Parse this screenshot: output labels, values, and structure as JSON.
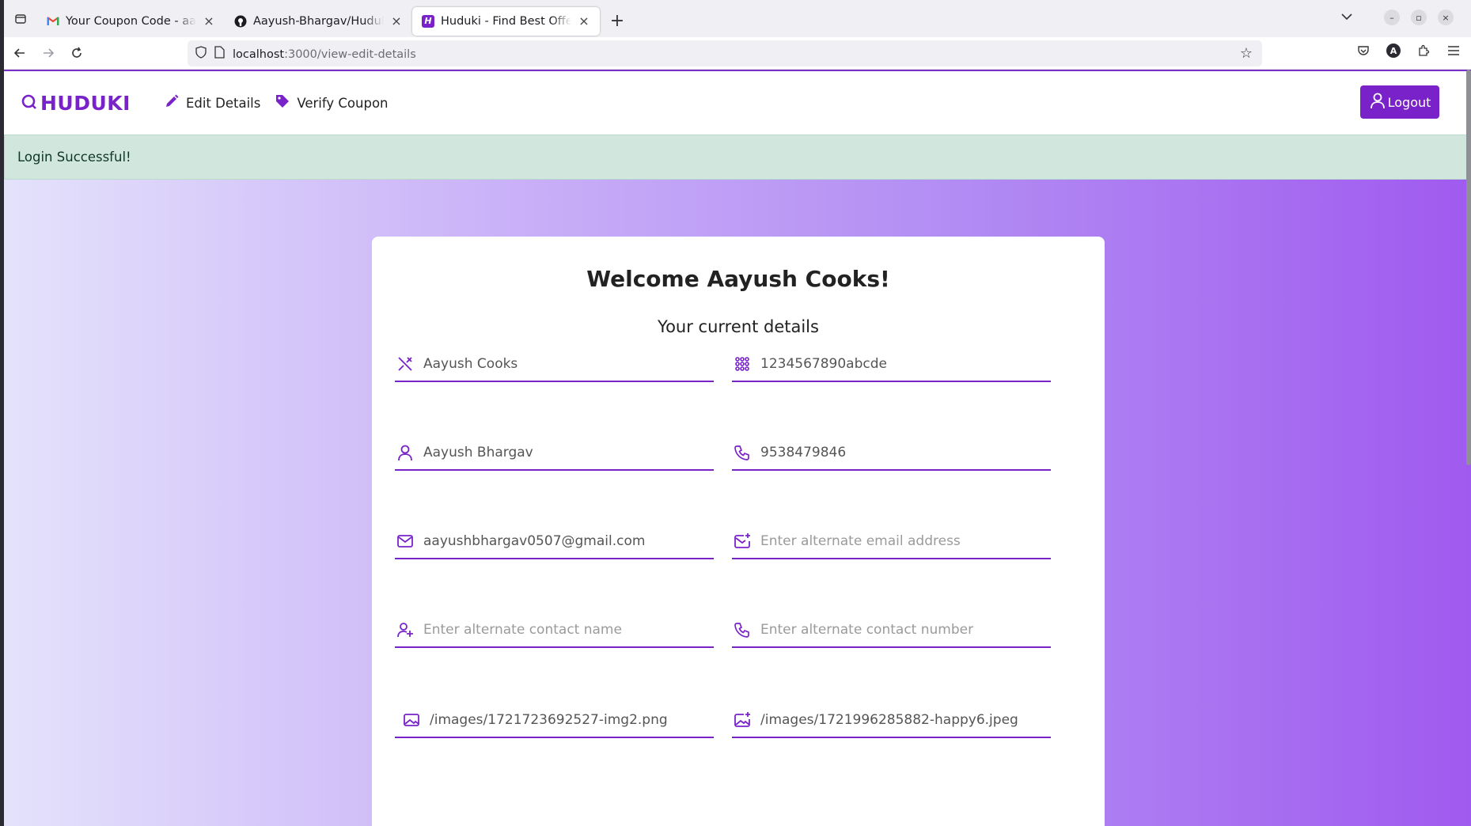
{
  "browser": {
    "tabs": [
      {
        "title": "Your Coupon Code - aayush",
        "favicon": "gmail-icon",
        "active": false
      },
      {
        "title": "Aayush-Bhargav/Huduki-F",
        "favicon": "github-icon",
        "active": false
      },
      {
        "title": "Huduki - Find Best Offers",
        "favicon": "huduki-icon",
        "active": true
      }
    ],
    "url_host": "localhost",
    "url_path": ":3000/view-edit-details",
    "account_initial": "A"
  },
  "header": {
    "brand": "HUDUKI",
    "links": [
      {
        "label": "Edit Details",
        "icon": "pencil-icon"
      },
      {
        "label": "Verify Coupon",
        "icon": "tag-icon"
      }
    ],
    "logout_label": "Logout"
  },
  "alert": {
    "message": "Login Successful!"
  },
  "card": {
    "title": "Welcome Aayush Cooks!",
    "subtitle": "Your current details",
    "fields": {
      "business_name": {
        "value": "Aayush Cooks",
        "placeholder": "",
        "icon": "utensils-icon"
      },
      "gst_number": {
        "value": "1234567890abcde",
        "placeholder": "",
        "icon": "grid-dots-icon"
      },
      "owner_name": {
        "value": "Aayush Bhargav",
        "placeholder": "",
        "icon": "user-icon"
      },
      "phone": {
        "value": "9538479846",
        "placeholder": "",
        "icon": "phone-icon"
      },
      "email": {
        "value": "aayushbhargav0507@gmail.com",
        "placeholder": "",
        "icon": "mail-icon"
      },
      "alt_email": {
        "value": "",
        "placeholder": "Enter alternate email address",
        "icon": "mail-plus-icon"
      },
      "alt_contact_name": {
        "value": "",
        "placeholder": "Enter alternate contact name",
        "icon": "user-plus-icon"
      },
      "alt_contact_number": {
        "value": "",
        "placeholder": "Enter alternate contact number",
        "icon": "phone-icon"
      },
      "image_1": {
        "value": "/images/1721723692527-img2.png",
        "placeholder": "",
        "icon": "image-icon"
      },
      "image_2": {
        "value": "/images/1721996285882-happy6.jpeg",
        "placeholder": "",
        "icon": "image-plus-icon"
      }
    }
  },
  "colors": {
    "primary": "#7a22c9",
    "alert_bg": "#d1e7dd"
  }
}
